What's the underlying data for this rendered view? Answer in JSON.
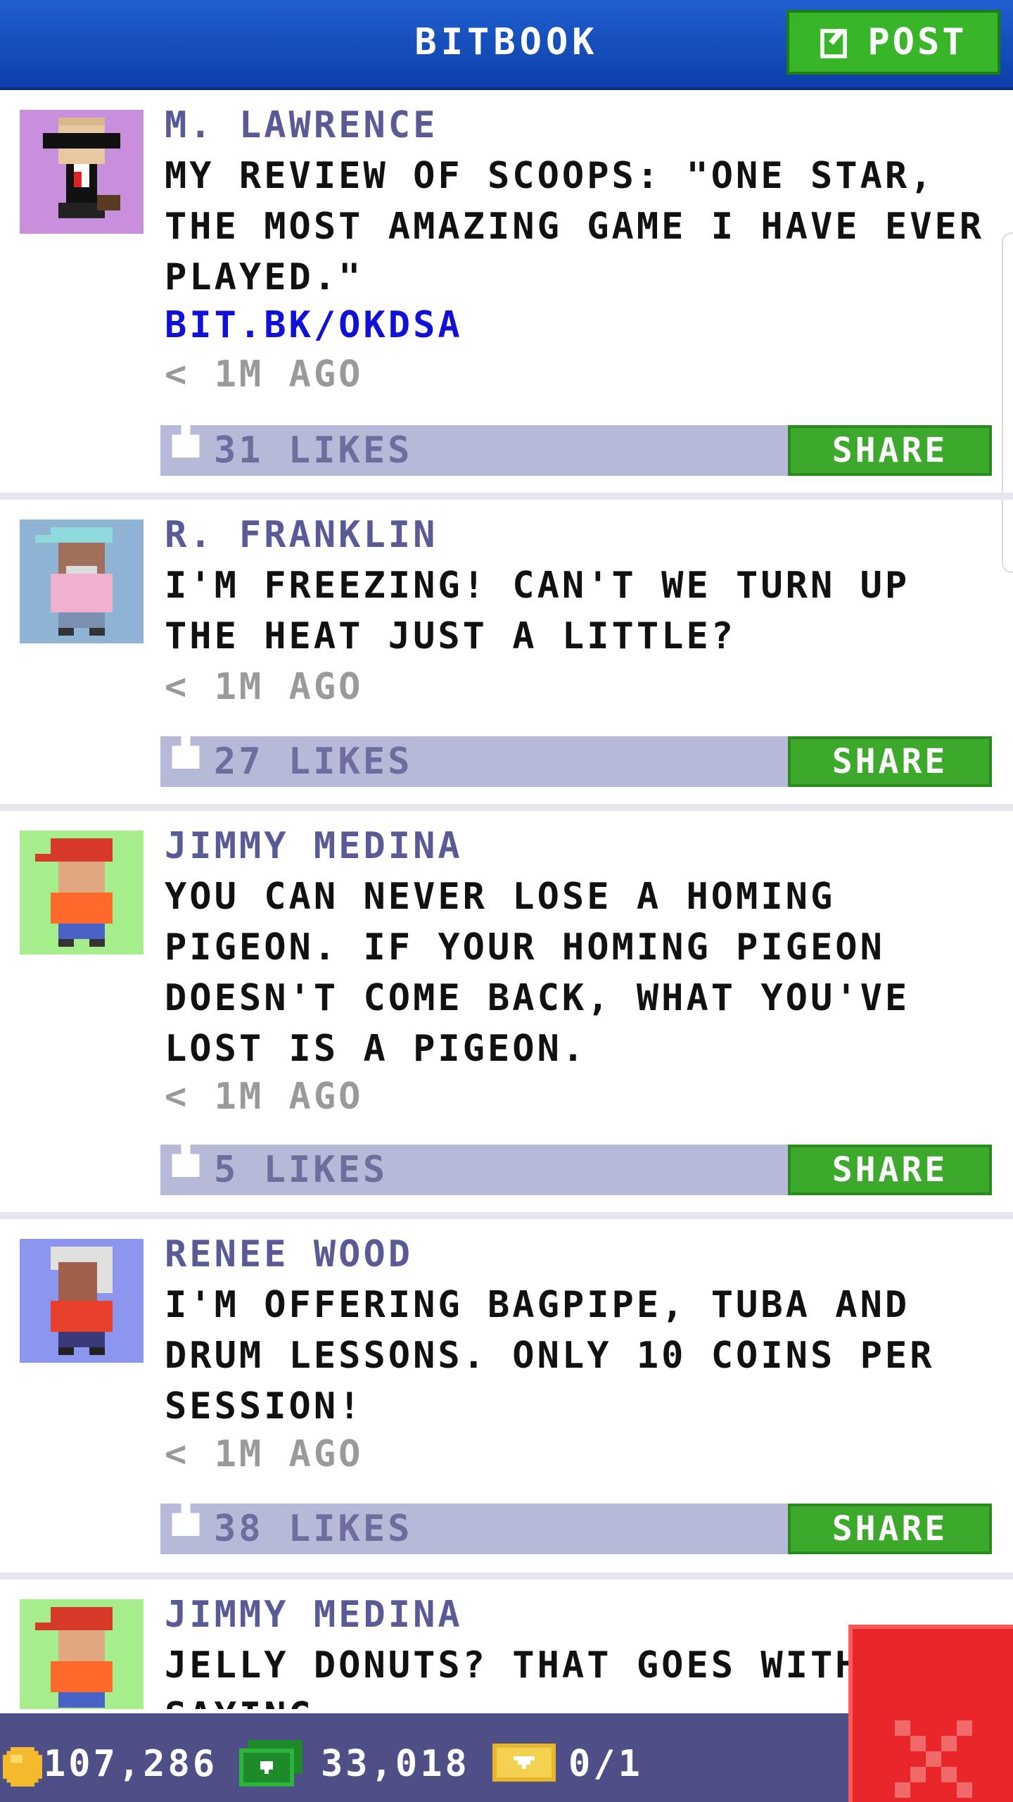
{
  "header": {
    "title": "BITBOOK",
    "post_label": "POST"
  },
  "posts": [
    {
      "author": "M. LAWRENCE",
      "message": "MY REVIEW OF SCOOPS: \"ONE STAR, THE MOST AMAZING GAME I HAVE EVER PLAYED.\"",
      "link": "BIT.BK/OKDSA",
      "time": "< 1M AGO",
      "likes": "31 LIKES",
      "share": "SHARE",
      "avatar_bg": "#c890dc"
    },
    {
      "author": "R. FRANKLIN",
      "message": "I'M FREEZING! CAN'T WE TURN UP THE HEAT JUST A LITTLE?",
      "time": "< 1M AGO",
      "likes": "27 LIKES",
      "share": "SHARE",
      "avatar_bg": "#8fb3d3"
    },
    {
      "author": "JIMMY MEDINA",
      "message": "YOU CAN NEVER LOSE A HOMING PIGEON. IF YOUR HOMING PIGEON DOESN'T COME BACK, WHAT YOU'VE LOST IS A PIGEON.",
      "time": "< 1M AGO",
      "likes": "5 LIKES",
      "share": "SHARE",
      "avatar_bg": "#a6ee8c"
    },
    {
      "author": "RENEE WOOD",
      "message": "I'M OFFERING BAGPIPE, TUBA AND DRUM LESSONS. ONLY 10 COINS PER SESSION!",
      "time": "< 1M AGO",
      "likes": "38 LIKES",
      "share": "SHARE",
      "avatar_bg": "#8c96ee"
    },
    {
      "author": "JIMMY MEDINA",
      "message": "JELLY DONUTS? THAT GOES WITHOUT SAYING",
      "avatar_bg": "#a6ee8c"
    }
  ],
  "footer": {
    "coins": "107,286",
    "bux": "33,018",
    "gold": "0/1"
  },
  "colors": {
    "header": "#1f5fd0",
    "post_button": "#39b52a",
    "share_button": "#3ca92c",
    "like_bar": "#b7b9d8",
    "footer": "#4d4f86",
    "close": "#e8262a"
  },
  "icons": [
    "post-edit-icon",
    "thumbs-up-icon",
    "coin-icon",
    "cash-icon",
    "gold-ticket-icon",
    "close-icon"
  ]
}
